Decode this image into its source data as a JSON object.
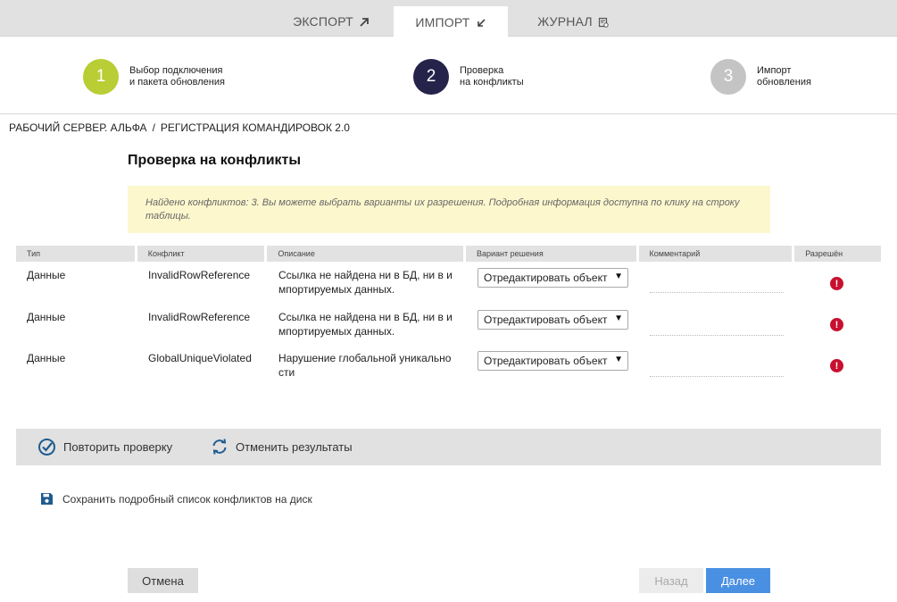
{
  "tabs": [
    {
      "label": "ЭКСПОРТ",
      "icon": "arrow-up-right-icon"
    },
    {
      "label": "ИМПОРТ",
      "icon": "arrow-down-left-icon"
    },
    {
      "label": "ЖУРНАЛ",
      "icon": "log-icon"
    }
  ],
  "steps": [
    {
      "number": "1",
      "line1": "Выбор подключения",
      "line2": "и пакета обновления",
      "color": "#b9cd35"
    },
    {
      "number": "2",
      "line1": "Проверка",
      "line2": "на конфликты",
      "color": "#25234a"
    },
    {
      "number": "3",
      "line1": "Импорт",
      "line2": "обновления",
      "color": "#c4c4c4"
    }
  ],
  "breadcrumb": {
    "server": "РАБОЧИЙ СЕРВЕР. АЛЬФА",
    "separator": "/",
    "package": "РЕГИСТРАЦИЯ КОМАНДИРОВОК 2.0"
  },
  "page_title": "Проверка на конфликты",
  "notice": "Найдено конфликтов: 3. Вы можете выбрать варианты их разрешения. Подробная информация доступна по клику на строку таблицы.",
  "table": {
    "headers": [
      "Тип",
      "Конфликт",
      "Описание",
      "Вариант решения",
      "Комментарий",
      "Разрешён"
    ],
    "rows": [
      {
        "type": "Данные",
        "conflict": "InvalidRowReference",
        "desc1": "Ссылка не найдена ни в БД, ни в и",
        "desc2": "мпортируемых данных.",
        "resolution": "Отредактировать объект",
        "comment": ""
      },
      {
        "type": "Данные",
        "conflict": "InvalidRowReference",
        "desc1": "Ссылка не найдена ни в БД, ни в и",
        "desc2": "мпортируемых данных.",
        "resolution": "Отредактировать объект",
        "comment": ""
      },
      {
        "type": "Данные",
        "conflict": "GlobalUniqueViolated",
        "desc1": "Нарушение глобальной уникально",
        "desc2": "сти",
        "resolution": "Отредактировать объект",
        "comment": ""
      }
    ]
  },
  "actions": {
    "recheck": "Повторить проверку",
    "cancel_results": "Отменить результаты"
  },
  "save_link": "Сохранить подробный список конфликтов на диск",
  "buttons": {
    "cancel": "Отмена",
    "back": "Назад",
    "next": "Далее"
  },
  "colors": {
    "accent": "#4a90e2",
    "error": "#c8102e",
    "icon_blue": "#1f5c8f"
  }
}
